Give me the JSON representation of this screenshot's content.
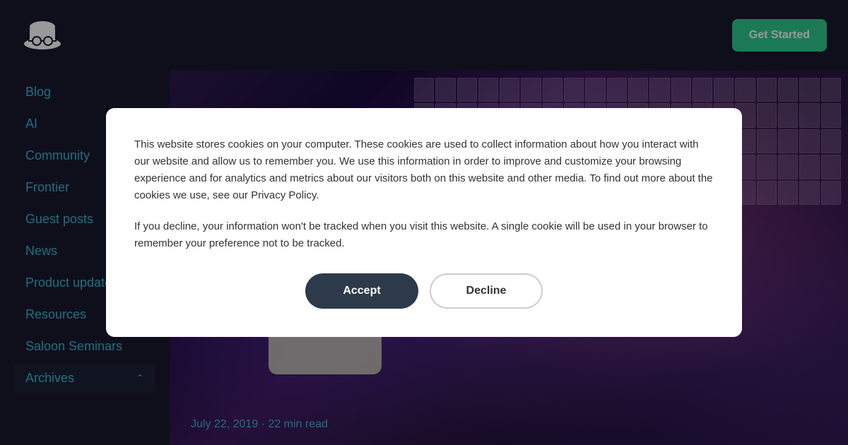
{
  "header": {
    "get_started_label": "Get Started",
    "logo_alt": "Logo"
  },
  "sidebar": {
    "nav_items": [
      {
        "label": "Blog",
        "href": "#"
      },
      {
        "label": "AI",
        "href": "#"
      },
      {
        "label": "Community",
        "href": "#"
      },
      {
        "label": "Frontier",
        "href": "#"
      },
      {
        "label": "Guest posts",
        "href": "#"
      },
      {
        "label": "News",
        "href": "#"
      },
      {
        "label": "Product updates",
        "href": "#"
      },
      {
        "label": "Resources",
        "href": "#"
      },
      {
        "label": "Saloon Seminars",
        "href": "#"
      }
    ],
    "archives_label": "Archives",
    "archives_chevron": "^"
  },
  "main": {
    "post_date": "July 22, 2019",
    "post_read_time": "22 min read",
    "post_date_separator": "·"
  },
  "cookie_modal": {
    "body_text_1": "This website stores cookies on your computer. These cookies are used to collect information about how you interact with our website and allow us to remember you. We use this information in order to improve and customize your browsing experience and for analytics and metrics about our visitors both on this website and other media. To find out more about the cookies we use, see our Privacy Policy.",
    "body_text_2": "If you decline, your information won't be tracked when you visit this website. A single cookie will be used in your browser to remember your preference not to be tracked.",
    "accept_label": "Accept",
    "decline_label": "Decline"
  }
}
